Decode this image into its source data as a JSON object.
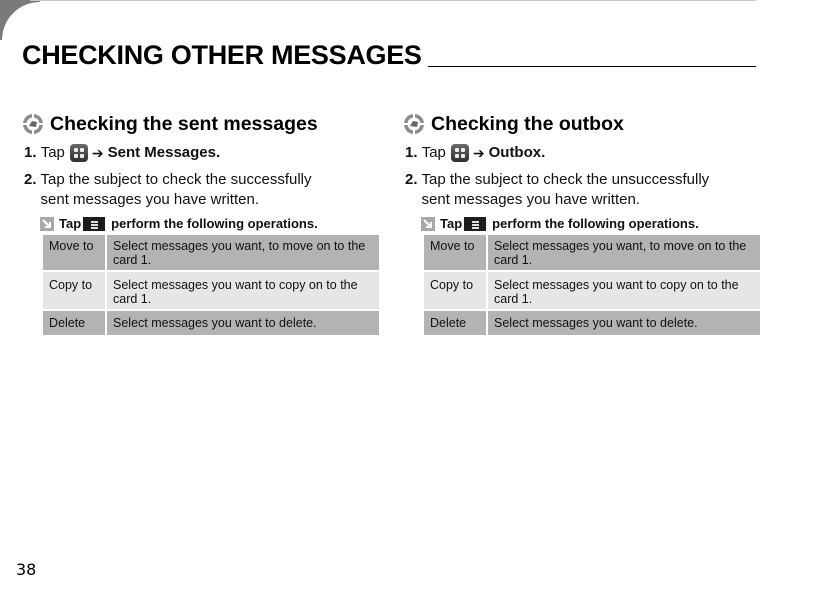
{
  "page": {
    "title": "CHECKING OTHER MESSAGES",
    "page_number": "38"
  },
  "sections": [
    {
      "heading": "Checking the sent messages",
      "icon": "section-bullet-icon",
      "step1": {
        "num": "1.",
        "text": "Tap",
        "icon": "menu-grid-icon",
        "arrow": "➔",
        "destination": "Sent Messages."
      },
      "step2": {
        "num": "2.",
        "text": "Tap the subject to check the successfully sent messages you have written."
      },
      "note": {
        "icon": "note-icon",
        "prefix": "Tap",
        "button_icon": "options-menu-icon",
        "suffix": "perform the following operations."
      },
      "operations": [
        {
          "name": "Move to",
          "desc": "Select messages you want, to move on to the card 1."
        },
        {
          "name": "Copy to",
          "desc": "Select messages you want to copy on to the card 1."
        },
        {
          "name": "Delete",
          "desc": "Select messages you want to delete."
        }
      ]
    },
    {
      "heading": "Checking the outbox",
      "icon": "section-bullet-icon",
      "step1": {
        "num": "1.",
        "text": "Tap",
        "icon": "menu-grid-icon",
        "arrow": "➔",
        "destination": "Outbox."
      },
      "step2": {
        "num": "2.",
        "text": "Tap the subject to check the unsuccessfully sent messages you have written."
      },
      "note": {
        "icon": "note-icon",
        "prefix": "Tap",
        "button_icon": "options-menu-icon",
        "suffix": "perform the following operations."
      },
      "operations": [
        {
          "name": "Move to",
          "desc": "Select messages you want, to move on to the card 1."
        },
        {
          "name": "Copy to",
          "desc": "Select messages you want to copy on to the card 1."
        },
        {
          "name": "Delete",
          "desc": "Select messages you want to delete."
        }
      ]
    }
  ],
  "colors": {
    "table_dark": "#b3b3b3",
    "table_light": "#e6e6e6",
    "corner_tab": "#7a7a7a"
  }
}
